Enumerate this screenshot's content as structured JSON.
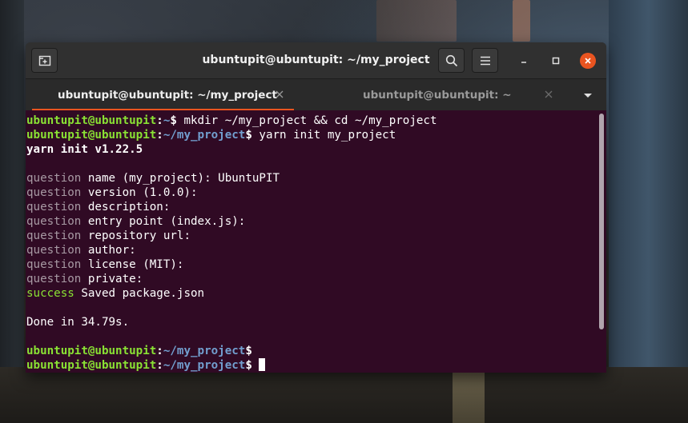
{
  "window": {
    "title": "ubuntupit@ubuntupit: ~/my_project",
    "accent_color": "#e95420",
    "terminal_bg": "#300a24"
  },
  "tabs": [
    {
      "label": "ubuntupit@ubuntupit: ~/my_project",
      "active": true
    },
    {
      "label": "ubuntupit@ubuntupit: ~",
      "active": false
    }
  ],
  "icons": {
    "new_tab": "new-tab-icon",
    "search": "search-icon",
    "menu": "hamburger-menu-icon",
    "minimize": "minimize-icon",
    "maximize": "maximize-icon",
    "close": "close-icon",
    "tab_close": "tab-close-icon",
    "tab_list": "chevron-down-icon"
  },
  "terminal": {
    "lines": [
      {
        "user": "ubuntupit@ubuntupit",
        "sep": ":",
        "path": "~",
        "sym": "$",
        "cmd": " mkdir ~/my_project && cd ~/my_project"
      },
      {
        "user": "ubuntupit@ubuntupit",
        "sep": ":",
        "path": "~/my_project",
        "sym": "$",
        "cmd": " yarn init my_project"
      },
      {
        "text": "yarn init v1.22.5"
      },
      {
        "text": ""
      },
      {
        "prefix": "question",
        "text": " name (my_project): UbuntuPIT"
      },
      {
        "prefix": "question",
        "text": " version (1.0.0):"
      },
      {
        "prefix": "question",
        "text": " description:"
      },
      {
        "prefix": "question",
        "text": " entry point (index.js):"
      },
      {
        "prefix": "question",
        "text": " repository url:"
      },
      {
        "prefix": "question",
        "text": " author:"
      },
      {
        "prefix": "question",
        "text": " license (MIT):"
      },
      {
        "prefix": "question",
        "text": " private:"
      },
      {
        "status": "success",
        "text": " Saved package.json"
      },
      {
        "text": ""
      },
      {
        "text": "Done in 34.79s."
      },
      {
        "text": ""
      },
      {
        "user": "ubuntupit@ubuntupit",
        "sep": ":",
        "path": "~/my_project",
        "sym": "$",
        "cmd": ""
      },
      {
        "user": "ubuntupit@ubuntupit",
        "sep": ":",
        "path": "~/my_project",
        "sym": "$",
        "cmd": " "
      }
    ]
  }
}
